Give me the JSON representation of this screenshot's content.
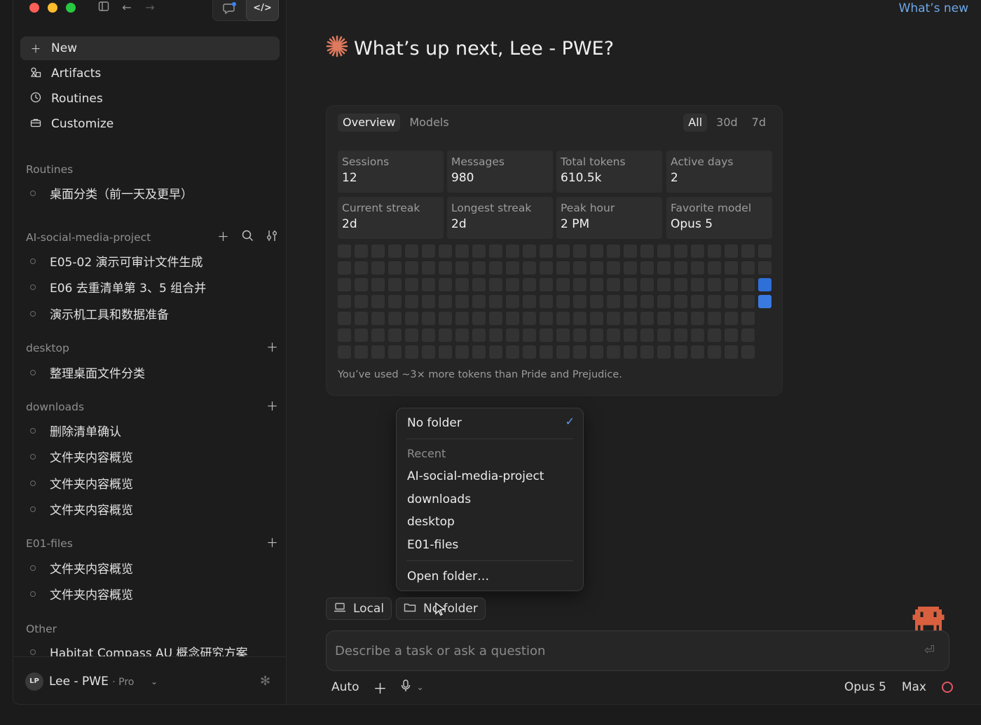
{
  "header": {
    "whats_new": "What’s new"
  },
  "sidebar": {
    "nav": [
      {
        "label": "New",
        "icon": "plus-icon"
      },
      {
        "label": "Artifacts",
        "icon": "artifacts-icon"
      },
      {
        "label": "Routines",
        "icon": "clock-icon"
      },
      {
        "label": "Customize",
        "icon": "briefcase-icon"
      }
    ],
    "sections": [
      {
        "title": "Routines",
        "items": [
          "桌面分类（前一天及更早）"
        ]
      },
      {
        "title": "AI-social-media-project",
        "items": [
          "E05-02 演示可审计文件生成",
          "E06 去重清单第 3、5 组合并",
          "演示机工具和数据准备"
        ]
      },
      {
        "title": "desktop",
        "items": [
          "整理桌面文件分类"
        ]
      },
      {
        "title": "downloads",
        "items": [
          "删除清单确认",
          "文件夹内容概览",
          "文件夹内容概览",
          "文件夹内容概览"
        ]
      },
      {
        "title": "E01-files",
        "items": [
          "文件夹内容概览",
          "文件夹内容概览"
        ]
      },
      {
        "title": "Other",
        "items": [
          "Habitat Compass AU 概念研究方案"
        ]
      }
    ],
    "footer": {
      "initials": "LP",
      "name": "Lee - PWE",
      "plan": "· Pro"
    }
  },
  "main": {
    "greeting": "What’s up next, Lee - PWE?",
    "stats": {
      "tabs": [
        "Overview",
        "Models"
      ],
      "ranges": [
        "All",
        "30d",
        "7d"
      ],
      "cards": [
        {
          "label": "Sessions",
          "value": "12"
        },
        {
          "label": "Messages",
          "value": "980"
        },
        {
          "label": "Total tokens",
          "value": "610.5k"
        },
        {
          "label": "Active days",
          "value": "2"
        },
        {
          "label": "Current streak",
          "value": "2d"
        },
        {
          "label": "Longest streak",
          "value": "2d"
        },
        {
          "label": "Peak hour",
          "value": "2 PM"
        },
        {
          "label": "Favorite model",
          "value": "Opus 5"
        }
      ],
      "heatmap": {
        "columns": 26,
        "rows": 7,
        "active": [
          {
            "col": 25,
            "row": 2,
            "level": 1
          },
          {
            "col": 25,
            "row": 3,
            "level": 2
          }
        ]
      },
      "footnote": "You’ve used ~3× more tokens than Pride and Prejudice."
    },
    "folder_menu": {
      "selected": "No folder",
      "recent_label": "Recent",
      "recent": [
        "AI-social-media-project",
        "downloads",
        "desktop",
        "E01-files"
      ],
      "open_folder": "Open folder…"
    },
    "chips": {
      "local": "Local",
      "folder": "No folder"
    },
    "composer": {
      "placeholder": "Describe a task or ask a question"
    },
    "bottom_bar": {
      "mode": "Auto",
      "model": "Opus 5",
      "effort": "Max"
    }
  },
  "colors": {
    "accent": "#5b9cf0",
    "star": "#e07a5f",
    "mascot": "#d9603f",
    "ring": "#e25563",
    "heat_active": "#2f6fd8"
  }
}
